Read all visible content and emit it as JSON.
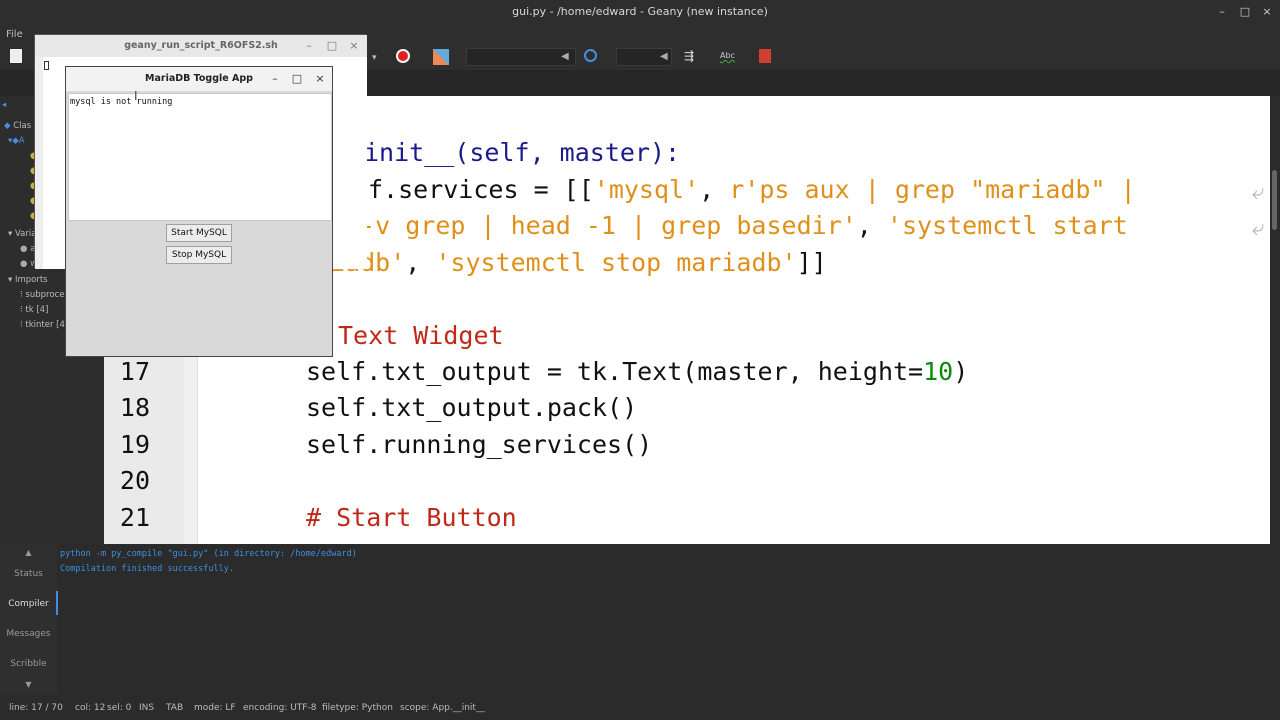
{
  "window": {
    "title": "gui.py - /home/edward - Geany (new instance)",
    "min": "–",
    "max": "□",
    "close": "×"
  },
  "menu": {
    "file": "File"
  },
  "sidebar": {
    "items": [
      "Clas",
      "Varia",
      "Imports",
      "subproces",
      "tk [4]",
      "tkinter [4]"
    ]
  },
  "editor": {
    "line_numbers": [
      "17",
      "18",
      "19",
      "20",
      "21"
    ],
    "lines": [
      {
        "a": "init__(self, master):"
      },
      {
        "a": "f.services = [[",
        "s1": "'mysql'",
        "b": ", ",
        "s2": "r'ps aux | grep \"mariadb\" |"
      },
      {
        "s": "p -v grep | head -1 | grep basedir'",
        "b": ", ",
        "s2": "'systemctl start"
      },
      {
        "s": "iadb'",
        "b": ", ",
        "s2": "'systemctl stop mariadb'",
        "c": "]]"
      },
      {
        "com": "Text Widget"
      },
      {
        "a": "self.txt_output = tk.Text(master, height=",
        "num": "10",
        "b": ")"
      },
      {
        "a": "self.txt_output.pack()"
      },
      {
        "a": "self.running_services()"
      },
      {
        "a": ""
      },
      {
        "com": "# Start Button"
      }
    ]
  },
  "messages": {
    "tabs": [
      "Status",
      "Compiler",
      "Messages",
      "Scribble"
    ],
    "lines": [
      "python -m py_compile \"gui.py\" (in directory: /home/edward)",
      "Compilation finished successfully."
    ]
  },
  "statusbar": {
    "line": "line: 17 / 70",
    "col": "col: 12",
    "sel": "sel: 0",
    "ins": "INS",
    "tab": "TAB",
    "mode": "mode: LF",
    "encoding": "encoding: UTF-8",
    "filetype": "filetype: Python",
    "scope": "scope: App.__init__"
  },
  "terminal": {
    "title": "geany_run_script_R6OFS2.sh"
  },
  "tkapp": {
    "title": "MariaDB Toggle App",
    "output": "mysql is not running",
    "start_label": "Start MySQL",
    "stop_label": "Stop MySQL"
  },
  "colors": {
    "accent": "#3d8fe0",
    "string": "#e0901a",
    "comment": "#c0281a",
    "number": "#0a8a0a"
  }
}
